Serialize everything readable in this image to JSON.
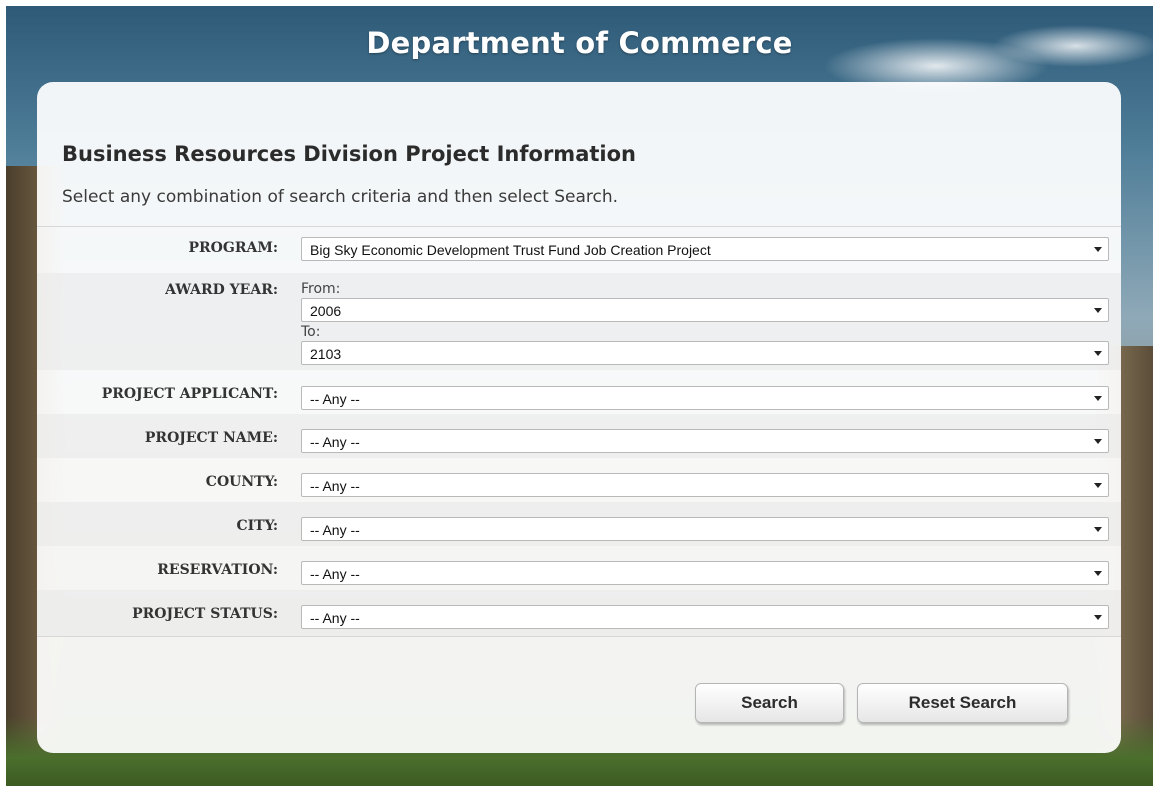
{
  "header": {
    "title": "Department of Commerce"
  },
  "form": {
    "heading": "Business Resources Division Project Information",
    "instructions": "Select any combination of search criteria and then select Search.",
    "program": {
      "label": "PROGRAM:",
      "value": "Big Sky Economic Development Trust Fund Job Creation Project"
    },
    "award_year": {
      "label": "AWARD YEAR:",
      "from_label": "From:",
      "from_value": "2006",
      "to_label": "To:",
      "to_value": "2103"
    },
    "project_applicant": {
      "label": "PROJECT APPLICANT:",
      "value": "-- Any --"
    },
    "project_name": {
      "label": "PROJECT NAME:",
      "value": "-- Any --"
    },
    "county": {
      "label": "COUNTY:",
      "value": "-- Any --"
    },
    "city": {
      "label": "CITY:",
      "value": "-- Any --"
    },
    "reservation": {
      "label": "RESERVATION:",
      "value": "-- Any --"
    },
    "project_status": {
      "label": "PROJECT STATUS:",
      "value": "-- Any --"
    }
  },
  "buttons": {
    "search": "Search",
    "reset": "Reset Search"
  }
}
